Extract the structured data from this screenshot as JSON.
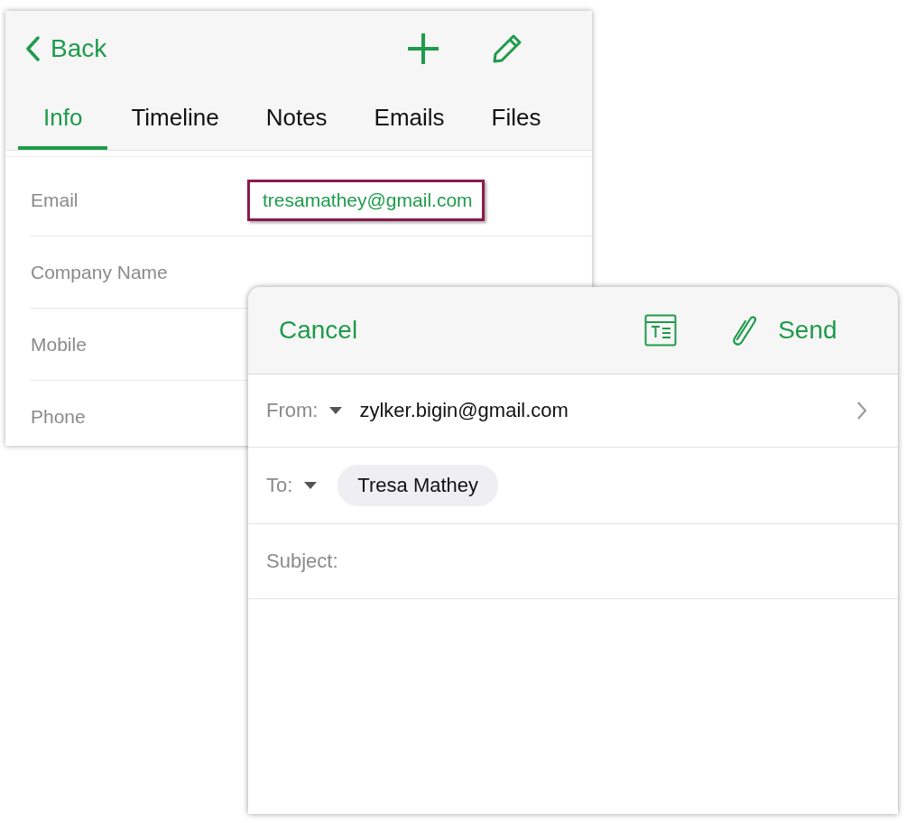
{
  "contact_screen": {
    "back_label": "Back",
    "tabs": [
      {
        "label": "Info",
        "selected": true
      },
      {
        "label": "Timeline",
        "selected": false
      },
      {
        "label": "Notes",
        "selected": false
      },
      {
        "label": "Emails",
        "selected": false
      },
      {
        "label": "Files",
        "selected": false
      }
    ],
    "fields": [
      {
        "label": "Email",
        "value": "tresamathey@gmail.com",
        "highlighted": true
      },
      {
        "label": "Company Name"
      },
      {
        "label": "Mobile"
      },
      {
        "label": "Phone"
      }
    ]
  },
  "compose": {
    "cancel_label": "Cancel",
    "send_label": "Send",
    "from": {
      "label": "From:",
      "value": "zylker.bigin@gmail.com"
    },
    "to": {
      "label": "To:",
      "recipients": [
        "Tresa Mathey"
      ]
    },
    "subject": {
      "label": "Subject:"
    }
  }
}
